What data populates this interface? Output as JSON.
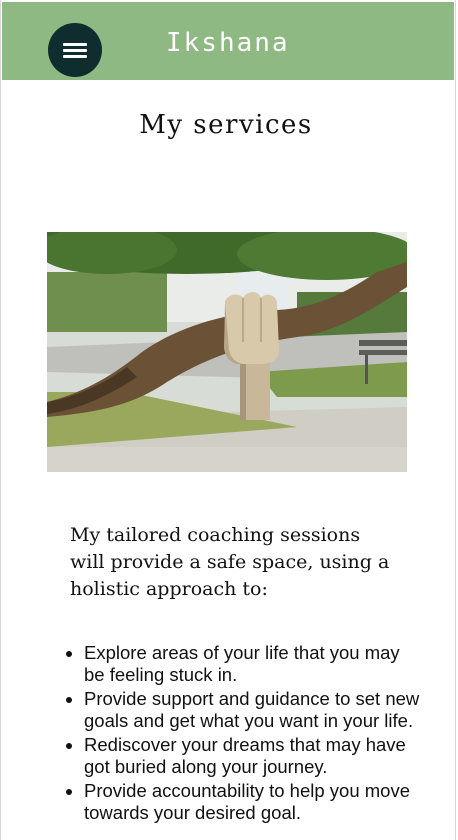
{
  "header": {
    "brand": "Ikshana",
    "menu_icon": "hamburger-menu-icon",
    "background_color": "#8fb982",
    "menu_button_color": "#0f2d2e"
  },
  "main": {
    "title": "My services",
    "hero_image_alt": "Wooden sculpted hand holding up a leaning tree trunk",
    "intro": "My tailored coaching sessions will provide a safe space, using a holistic approach to:",
    "benefits": [
      "Explore areas of your life that you may be feeling stuck in.",
      "Provide support and guidance to set new goals and get what you want in your life.",
      "Rediscover your dreams that may have got buried along your journey.",
      "Provide accountability to help you move towards your desired goal."
    ]
  }
}
